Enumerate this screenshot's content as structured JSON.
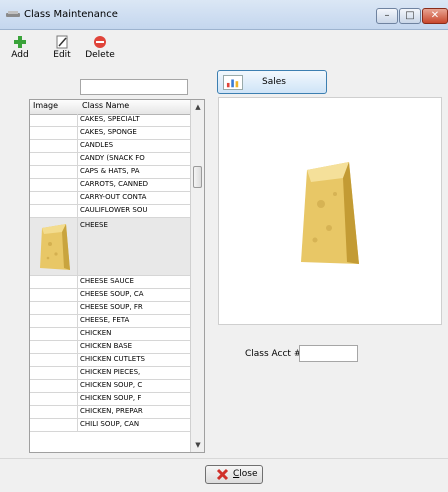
{
  "window": {
    "title": "Class Maintenance"
  },
  "toolbar": {
    "add_label": "Add",
    "edit_label": "Edit",
    "delete_label": "Delete"
  },
  "search": {
    "value": ""
  },
  "grid": {
    "columns": [
      "Image",
      "Class Name"
    ],
    "rows": [
      "CAKES, SPECIALT",
      "CAKES, SPONGE",
      "CANDLES",
      "CANDY (SNACK FO",
      "CAPS & HATS, PA",
      "CARROTS, CANNED",
      "CARRY-OUT CONTA",
      "CAULIFLOWER SOU",
      "CHEESE",
      "CHEESE SAUCE",
      "CHEESE SOUP, CA",
      "CHEESE SOUP, FR",
      "CHEESE, FETA",
      "CHICKEN",
      "CHICKEN BASE",
      "CHICKEN CUTLETS",
      "CHICKEN PIECES,",
      "CHICKEN SOUP, C",
      "CHICKEN SOUP, F",
      "CHICKEN, PREPAR",
      "CHILI SOUP, CAN"
    ],
    "selected_row": "CHEESE"
  },
  "sales_button": {
    "label": "Sales"
  },
  "class_acct": {
    "label": "Class Acct #",
    "value": ""
  },
  "close_button": {
    "prefix": "",
    "accel": "C",
    "rest": "lose"
  }
}
